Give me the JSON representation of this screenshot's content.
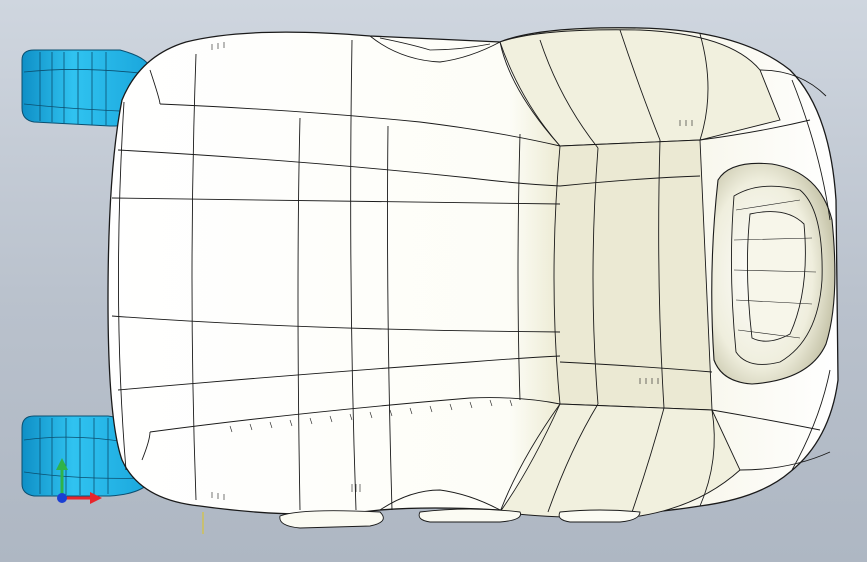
{
  "viewport": {
    "view": "top",
    "background_colors": [
      "#cfd6df",
      "#aeb7c3"
    ]
  },
  "model": {
    "name": "",
    "parts": [
      {
        "name": "seat-body",
        "color": "#fbfbf3"
      },
      {
        "name": "rail-bracket-upper",
        "color": "#1fb8e8"
      },
      {
        "name": "rail-bracket-lower",
        "color": "#1fb8e8"
      }
    ],
    "edge_color": "#1a1a1a",
    "shade_color": "#e6e4c9"
  },
  "triad": {
    "axes": [
      {
        "name": "x-axis",
        "color": "#e8252b"
      },
      {
        "name": "y-axis",
        "color": "#2fb34a"
      },
      {
        "name": "z-axis",
        "color": "#1a3fd4"
      }
    ]
  }
}
